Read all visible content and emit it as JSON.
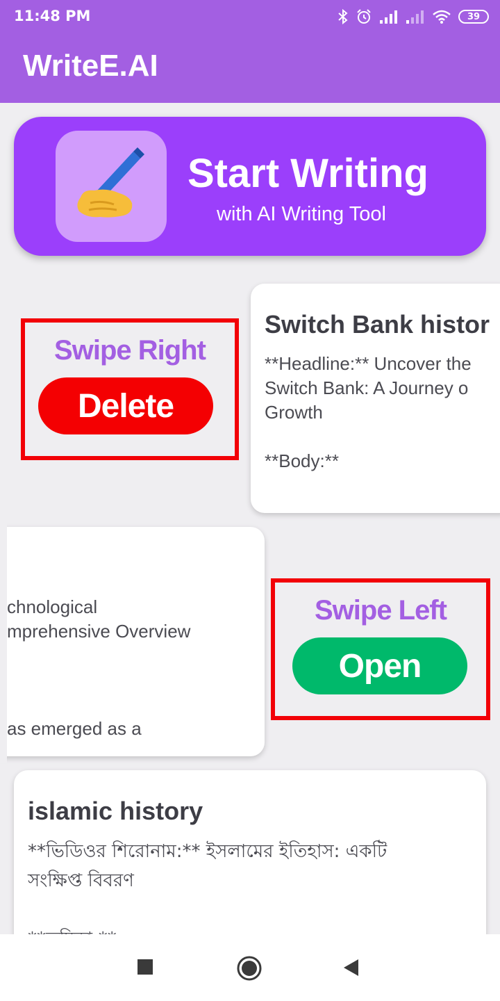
{
  "status_bar": {
    "time": "11:48 PM",
    "battery": "39"
  },
  "app_bar": {
    "title": "WriteE.AI"
  },
  "hero": {
    "icon": "writing-hand-emoji",
    "title": "Start Writing",
    "subtitle": "with AI Writing Tool"
  },
  "swipe_right_hint": {
    "label": "Swipe Right",
    "action": "Delete",
    "action_color": "#f40002"
  },
  "swipe_left_hint": {
    "label": "Swipe Left",
    "action": "Open",
    "action_color": "#00b96b"
  },
  "cards": [
    {
      "title": "Switch Bank histor",
      "body": "**Headline:** Uncover the\nSwitch Bank: A Journey o\nGrowth\n\n**Body:**"
    },
    {
      "title": "",
      "body": "chnological\nmprehensive Overview\n\n\n\nas emerged as a"
    },
    {
      "title": "islamic history",
      "body": "**ভিডিওর শিরোনাম:** ইসলামের ইতিহাস: একটি\nসংক্ষিপ্ত বিবরণ\n\n**ভূমিকা:**"
    }
  ],
  "nav_bar": {
    "recent": "recents-square-icon",
    "home": "home-circle-icon",
    "back": "back-triangle-icon"
  },
  "colors": {
    "accent": "#a35fe2",
    "hero_bg": "#9b3ffb",
    "highlight_border": "#f20007"
  }
}
